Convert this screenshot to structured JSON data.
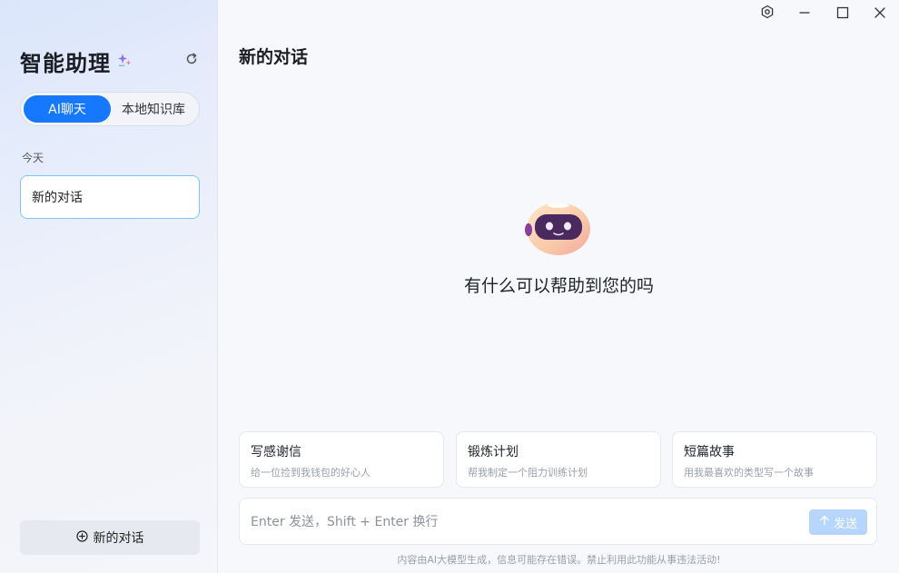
{
  "sidebar": {
    "brand": "智能助理",
    "tabs": [
      {
        "label": "AI聊天",
        "active": true
      },
      {
        "label": "本地知识库",
        "active": false
      }
    ],
    "section_label": "今天",
    "conversations": [
      {
        "title": "新的对话",
        "selected": true
      }
    ],
    "new_chat_label": "新的对话"
  },
  "main": {
    "title": "新的对话",
    "greeting": "有什么可以帮助到您的吗",
    "suggestions": [
      {
        "title": "写感谢信",
        "desc": "给一位捡到我钱包的好心人"
      },
      {
        "title": "锻炼计划",
        "desc": "帮我制定一个阻力训练计划"
      },
      {
        "title": "短篇故事",
        "desc": "用我最喜欢的类型写一个故事"
      }
    ],
    "input": {
      "placeholder": "Enter 发送，Shift + Enter 换行",
      "value": ""
    },
    "send_label": "发送",
    "disclaimer": "内容由AI大模型生成，信息可能存在错误。禁止利用此功能从事违法活动!"
  },
  "window_controls": [
    "settings-icon",
    "minimize-icon",
    "maximize-icon",
    "close-icon"
  ],
  "colors": {
    "accent": "#1677ff",
    "send_disabled": "#b6d6ff",
    "selected_border": "#7ec3ff"
  }
}
